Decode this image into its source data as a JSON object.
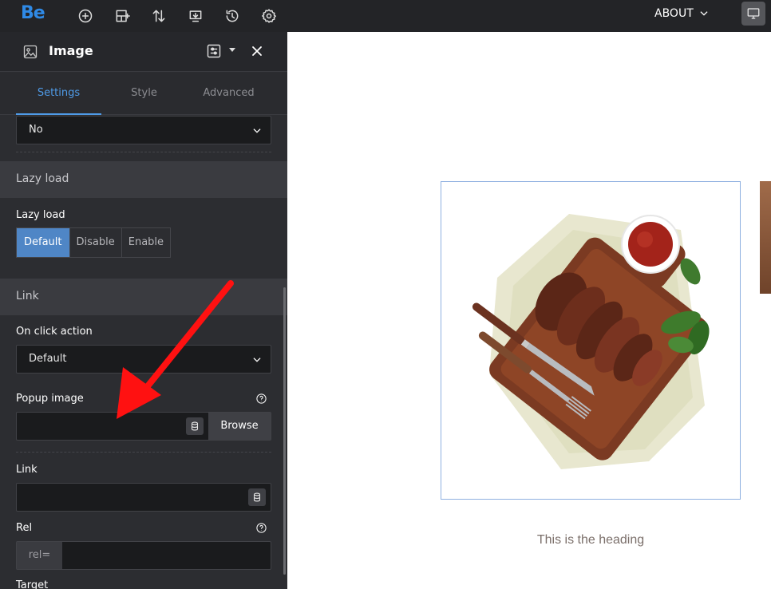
{
  "topbar": {
    "logo": "Be",
    "menu_label": "ABOUT",
    "icons": [
      "add-icon",
      "layout-icon",
      "sort-icon",
      "export-icon",
      "history-icon",
      "gear-icon",
      "chevron-down-icon",
      "desktop-icon"
    ]
  },
  "panel": {
    "title": "Image",
    "tabs": [
      "Settings",
      "Style",
      "Advanced"
    ],
    "active_tab": "Settings",
    "top_select": {
      "value": "No"
    },
    "lazy_section": "Lazy load",
    "lazy_label": "Lazy load",
    "lazy_options": [
      "Default",
      "Disable",
      "Enable"
    ],
    "lazy_selected": "Default",
    "link_section": "Link",
    "on_click_label": "On click action",
    "on_click_value": "Default",
    "popup_label": "Popup image",
    "popup_value": "",
    "browse_label": "Browse",
    "link_label": "Link",
    "link_value": "",
    "rel_label": "Rel",
    "rel_prefix": "rel=",
    "rel_value": "",
    "target_label": "Target"
  },
  "canvas": {
    "heading": "This is the heading"
  },
  "colors": {
    "accent": "#4f9be8",
    "arrow": "#ff1111",
    "panel_bg": "#2c2d31"
  }
}
